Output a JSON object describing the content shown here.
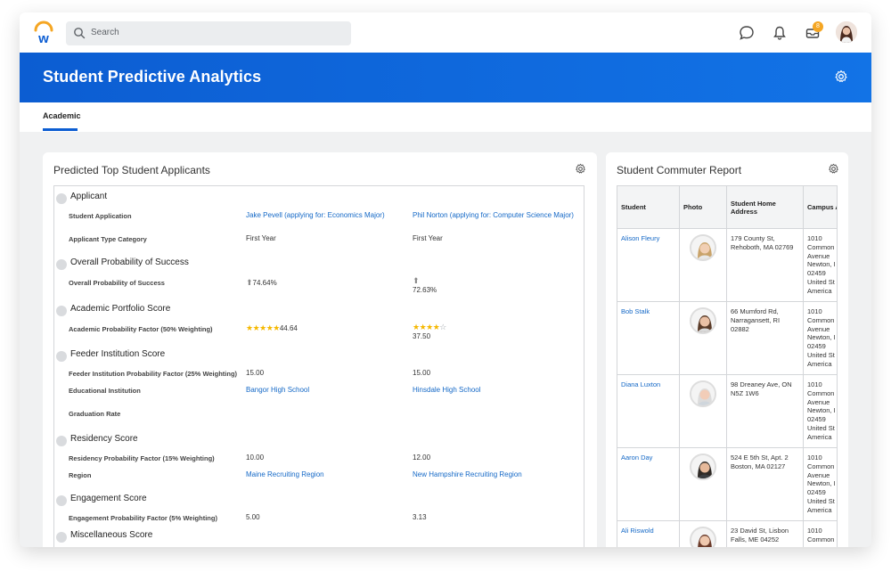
{
  "topnav": {
    "search_placeholder": "Search",
    "inbox_badge": "8"
  },
  "header": {
    "title": "Student Predictive Analytics"
  },
  "tabs": [
    {
      "label": "Academic"
    }
  ],
  "applicants": {
    "title": "Predicted Top Student Applicants",
    "sections": [
      {
        "heading": "Applicant",
        "rows": [
          {
            "label": "Student Application",
            "v1": "Jake Pevell (applying for: Economics Major)",
            "v2": "Phil Norton (applying for: Computer Science Major)"
          },
          {
            "label": "Applicant Type Category",
            "v1": "First Year",
            "v2": "First Year"
          }
        ]
      },
      {
        "heading": "Overall Probability of Success",
        "rows": [
          {
            "label": "Overall Probability of Success",
            "v1": "74.64%",
            "v2": "72.63%"
          }
        ]
      },
      {
        "heading": "Academic Portfolio Score",
        "rows": [
          {
            "label": "Academic Probability Factor (50% Weighting)",
            "v1": "44.64",
            "v2": "37.50",
            "v1_stars": 5,
            "v2_stars": 4
          }
        ]
      },
      {
        "heading": "Feeder Institution Score",
        "rows": [
          {
            "label": "Feeder Institution Probability Factor (25% Weighting)",
            "v1": "15.00",
            "v2": "15.00"
          },
          {
            "label": "Educational Institution",
            "v1": "Bangor High School",
            "v2": "Hinsdale High School"
          },
          {
            "label": "Graduation Rate",
            "v1": "",
            "v2": ""
          }
        ]
      },
      {
        "heading": "Residency Score",
        "rows": [
          {
            "label": "Residency Probability Factor (15% Weighting)",
            "v1": "10.00",
            "v2": "12.00"
          },
          {
            "label": "Region",
            "v1": "Maine Recruiting Region",
            "v2": "New Hampshire Recruiting Region"
          }
        ]
      },
      {
        "heading": "Engagement Score",
        "rows": [
          {
            "label": "Engagement Probability Factor (5% Weighting)",
            "v1": "5.00",
            "v2": "3.13"
          }
        ]
      },
      {
        "heading": "Miscellaneous Score",
        "rows": []
      }
    ]
  },
  "commuter": {
    "title": "Student Commuter Report",
    "columns": [
      "Student",
      "Photo",
      "Student Home Address",
      "Campus A"
    ],
    "rows": [
      {
        "student": "Alison Fleury",
        "address": "179 County St, Rehoboth, MA 02769",
        "campus": [
          "1010",
          "Common",
          "Avenue",
          "Newton, I",
          "02459",
          "United St",
          "America"
        ]
      },
      {
        "student": "Bob Stalk",
        "address": "66 Mumford Rd, Narragansett, RI 02882",
        "campus": [
          "1010",
          "Common",
          "Avenue",
          "Newton, I",
          "02459",
          "United St",
          "America"
        ]
      },
      {
        "student": "Diana Luxton",
        "address": "98 Dreaney Ave, ON N5Z 1W6",
        "campus": [
          "1010",
          "Common",
          "Avenue",
          "Newton, I",
          "02459",
          "United St",
          "America"
        ]
      },
      {
        "student": "Aaron Day",
        "address": "524 E 5th St, Apt. 2 Boston, MA 02127",
        "campus": [
          "1010",
          "Common",
          "Avenue",
          "Newton, I",
          "02459",
          "United St",
          "America"
        ]
      },
      {
        "student": "Ali Riswold",
        "address": "23 David St, Lisbon Falls, ME 04252",
        "campus": [
          "1010",
          "Common"
        ]
      }
    ]
  },
  "colors": {
    "brand_blue": "#0c5dd2",
    "link": "#1569c7",
    "badge": "#f5a623",
    "star": "#f5b800"
  }
}
